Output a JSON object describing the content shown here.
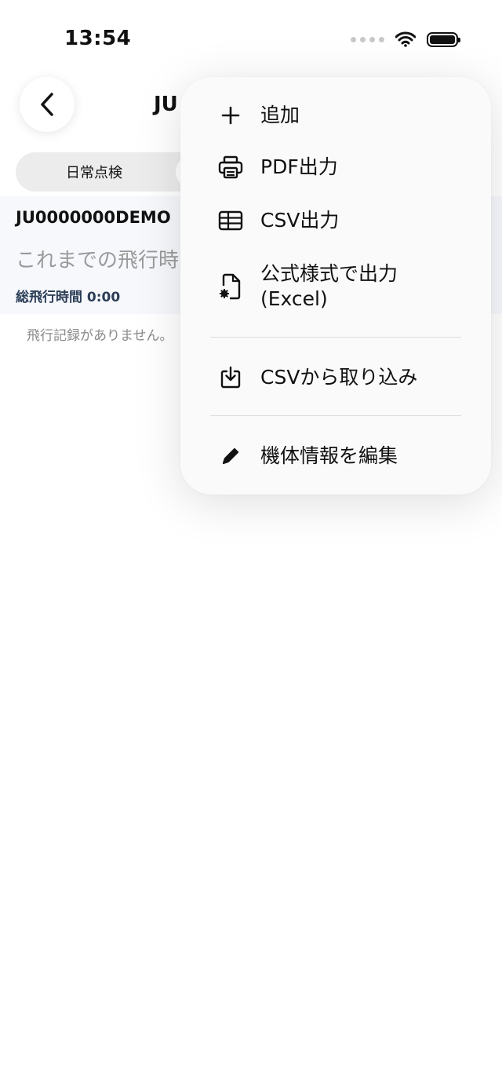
{
  "status_bar": {
    "time": "13:54",
    "icons": [
      "signal-dots-icon",
      "wifi-icon",
      "battery-icon"
    ]
  },
  "header": {
    "back_icon": "chevron-left-icon",
    "title": "JU"
  },
  "tabs": [
    {
      "label": "日常点検"
    }
  ],
  "aircraft": {
    "id": "JU0000000DEMO",
    "history_heading": "これまでの飛行時",
    "total_flight_label": "総飛行時間",
    "total_flight_value": "0:00",
    "empty_message": "飛行記録がありません。"
  },
  "menu": {
    "items": [
      {
        "icon": "plus-icon",
        "label": "追加"
      },
      {
        "icon": "printer-icon",
        "label": "PDF出力"
      },
      {
        "icon": "table-icon",
        "label": "CSV出力"
      },
      {
        "icon": "document-gear-icon",
        "label": "公式様式で出力",
        "label_line2": "(Excel)"
      },
      {
        "icon": "import-tray-icon",
        "label": "CSVから取り込み"
      },
      {
        "icon": "pencil-icon",
        "label": "機体情報を編集"
      }
    ]
  },
  "colors": {
    "menu_background": "#fafafa",
    "segment_background": "#ececec",
    "card_background": "#f6f8fc",
    "total_flight_text": "#2c3e56",
    "muted_text": "#9a9a9a"
  }
}
